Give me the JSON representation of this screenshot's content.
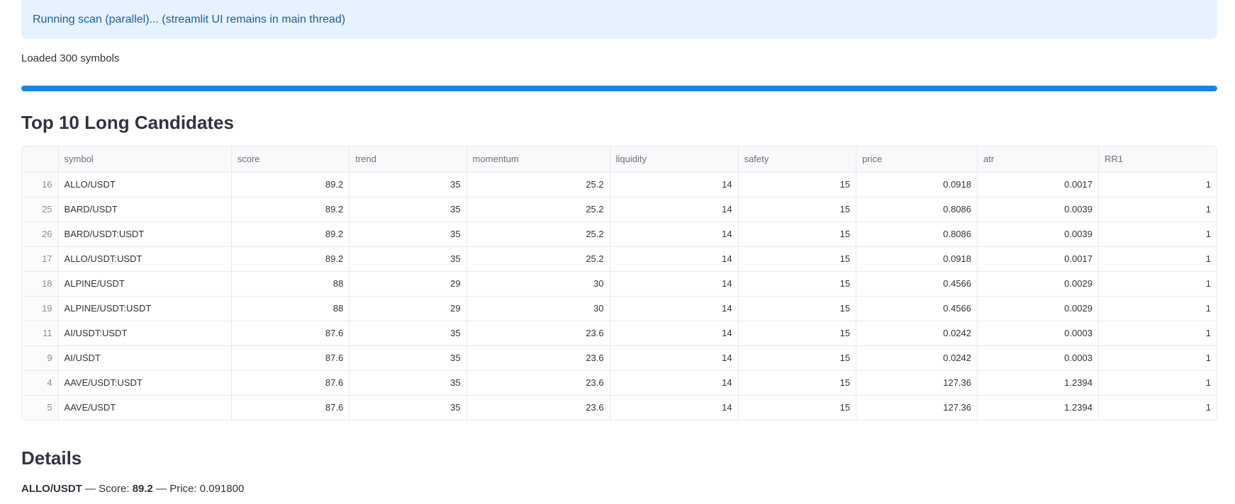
{
  "info": {
    "message": "Running scan (parallel)... (streamlit UI remains in main thread)",
    "color": "#e6f2fd"
  },
  "status": {
    "loaded_text": "Loaded 300 symbols"
  },
  "progress": {
    "percent": 100,
    "color": "#1c83e1"
  },
  "top_section": {
    "title": "Top 10 Long Candidates"
  },
  "table": {
    "columns": [
      "",
      "symbol",
      "score",
      "trend",
      "momentum",
      "liquidity",
      "safety",
      "price",
      "atr",
      "RR1"
    ],
    "rows": [
      [
        "16",
        "ALLO/USDT",
        "89.2",
        "35",
        "25.2",
        "14",
        "15",
        "0.0918",
        "0.0017",
        "1"
      ],
      [
        "25",
        "BARD/USDT",
        "89.2",
        "35",
        "25.2",
        "14",
        "15",
        "0.8086",
        "0.0039",
        "1"
      ],
      [
        "26",
        "BARD/USDT:USDT",
        "89.2",
        "35",
        "25.2",
        "14",
        "15",
        "0.8086",
        "0.0039",
        "1"
      ],
      [
        "17",
        "ALLO/USDT:USDT",
        "89.2",
        "35",
        "25.2",
        "14",
        "15",
        "0.0918",
        "0.0017",
        "1"
      ],
      [
        "18",
        "ALPINE/USDT",
        "88",
        "29",
        "30",
        "14",
        "15",
        "0.4566",
        "0.0029",
        "1"
      ],
      [
        "19",
        "ALPINE/USDT:USDT",
        "88",
        "29",
        "30",
        "14",
        "15",
        "0.4566",
        "0.0029",
        "1"
      ],
      [
        "11",
        "AI/USDT:USDT",
        "87.6",
        "35",
        "23.6",
        "14",
        "15",
        "0.0242",
        "0.0003",
        "1"
      ],
      [
        "9",
        "AI/USDT",
        "87.6",
        "35",
        "23.6",
        "14",
        "15",
        "0.0242",
        "0.0003",
        "1"
      ],
      [
        "4",
        "AAVE/USDT:USDT",
        "87.6",
        "35",
        "23.6",
        "14",
        "15",
        "127.36",
        "1.2394",
        "1"
      ],
      [
        "5",
        "AAVE/USDT",
        "87.6",
        "35",
        "23.6",
        "14",
        "15",
        "127.36",
        "1.2394",
        "1"
      ]
    ]
  },
  "details": {
    "title": "Details",
    "symbol": "ALLO/USDT",
    "sep1": " — Score: ",
    "score": "89.2",
    "sep2": " — Price: ",
    "price": "0.091800"
  }
}
